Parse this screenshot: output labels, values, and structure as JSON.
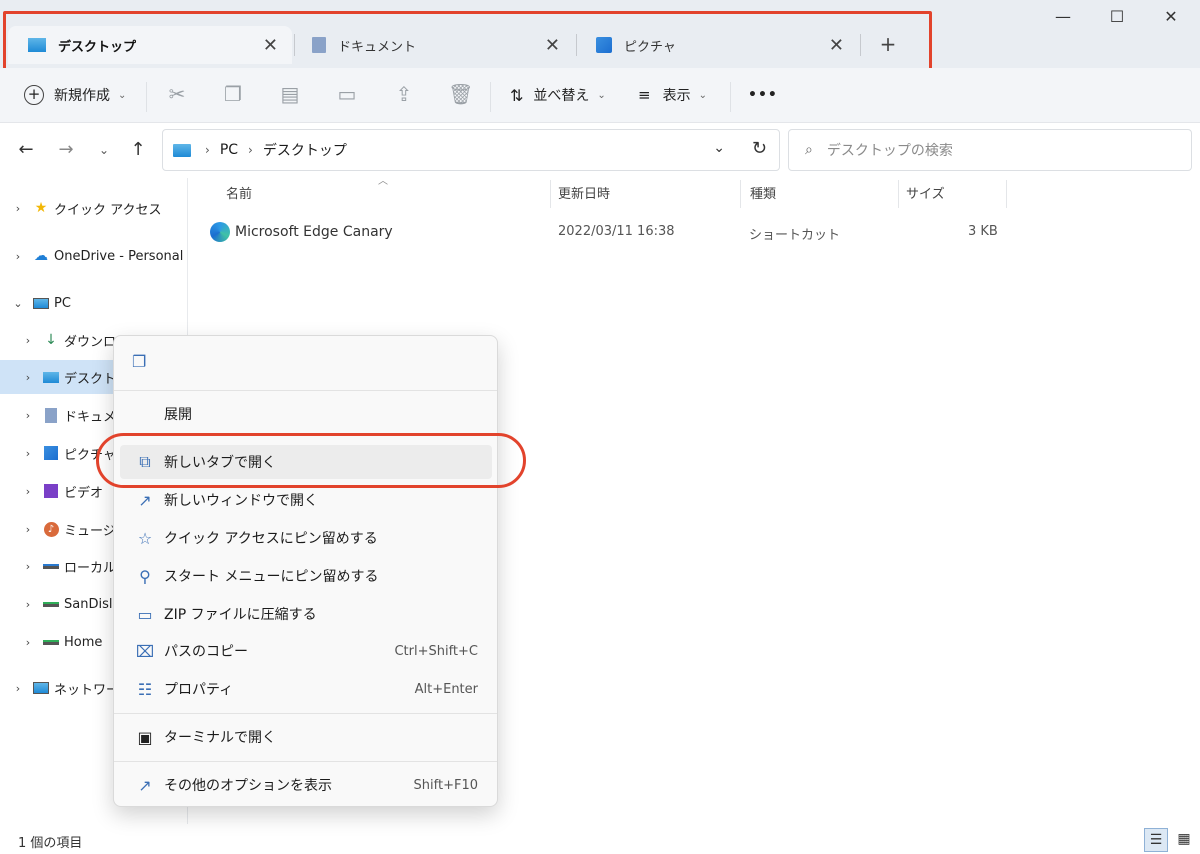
{
  "tabs": [
    {
      "label": "デスクトップ",
      "icon": "desktop-icon",
      "active": true
    },
    {
      "label": "ドキュメント",
      "icon": "document-icon",
      "active": false
    },
    {
      "label": "ピクチャ",
      "icon": "picture-icon",
      "active": false
    }
  ],
  "window": {
    "minimize": "—",
    "maximize": "☐",
    "close": "✕",
    "newtab": "+"
  },
  "toolbar": {
    "new_label": "新規作成",
    "sort_label": "並べ替え",
    "view_label": "表示",
    "more": "•••"
  },
  "address": {
    "root": "PC",
    "current": "デスクトップ"
  },
  "search": {
    "placeholder": "デスクトップの検索"
  },
  "sidebar": {
    "items": [
      {
        "label": "クイック アクセス"
      },
      {
        "label": "OneDrive - Personal"
      },
      {
        "label": "PC"
      },
      {
        "label": "ダウンロ"
      },
      {
        "label": "デスクトッ"
      },
      {
        "label": "ドキュメン"
      },
      {
        "label": "ピクチャ"
      },
      {
        "label": "ビデオ"
      },
      {
        "label": "ミュージッ"
      },
      {
        "label": "ローカル"
      },
      {
        "label": "SanDisl"
      },
      {
        "label": "Home"
      },
      {
        "label": "ネットワーク"
      }
    ]
  },
  "columns": {
    "name": "名前",
    "modified": "更新日時",
    "type": "種類",
    "size": "サイズ"
  },
  "files": [
    {
      "name": "Microsoft Edge Canary",
      "modified": "2022/03/11 16:38",
      "type": "ショートカット",
      "size": "3 KB"
    }
  ],
  "status": {
    "count": "1 個の項目"
  },
  "context_menu": {
    "items": [
      {
        "label": "展開",
        "key": ""
      },
      {
        "label": "新しいタブで開く",
        "key": ""
      },
      {
        "label": "新しいウィンドウで開く",
        "key": ""
      },
      {
        "label": "クイック アクセスにピン留めする",
        "key": ""
      },
      {
        "label": "スタート メニューにピン留めする",
        "key": ""
      },
      {
        "label": "ZIP ファイルに圧縮する",
        "key": ""
      },
      {
        "label": "パスのコピー",
        "key": "Ctrl+Shift+C"
      },
      {
        "label": "プロパティ",
        "key": "Alt+Enter"
      },
      {
        "label": "ターミナルで開く",
        "key": ""
      },
      {
        "label": "その他のオプションを表示",
        "key": "Shift+F10"
      }
    ]
  },
  "colors": {
    "accent": "#1f8ad6",
    "highlight": "#e2432c",
    "selection": "#cfe3f7"
  }
}
